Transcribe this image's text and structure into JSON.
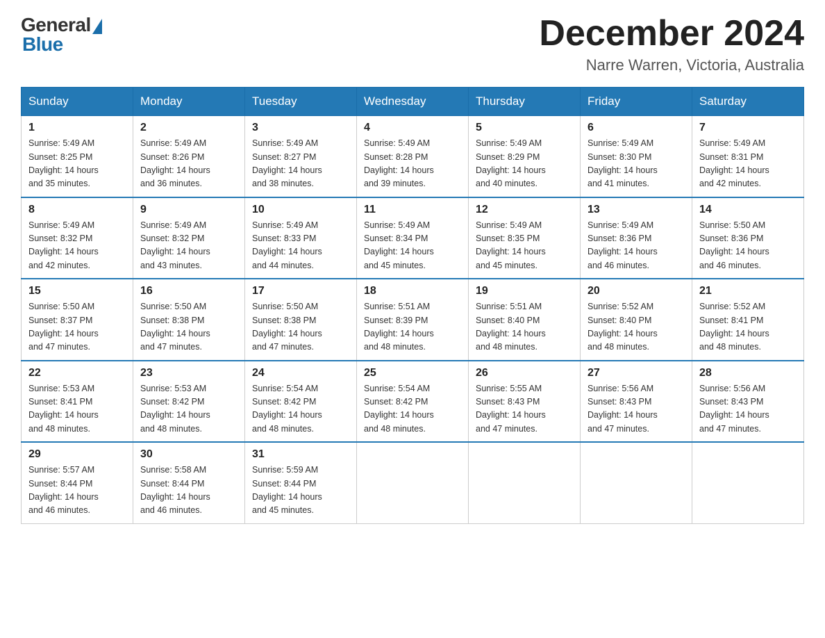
{
  "header": {
    "logo_general": "General",
    "logo_blue": "Blue",
    "month_title": "December 2024",
    "location": "Narre Warren, Victoria, Australia"
  },
  "days_of_week": [
    "Sunday",
    "Monday",
    "Tuesday",
    "Wednesday",
    "Thursday",
    "Friday",
    "Saturday"
  ],
  "weeks": [
    [
      {
        "day": "1",
        "sunrise": "5:49 AM",
        "sunset": "8:25 PM",
        "daylight": "14 hours and 35 minutes."
      },
      {
        "day": "2",
        "sunrise": "5:49 AM",
        "sunset": "8:26 PM",
        "daylight": "14 hours and 36 minutes."
      },
      {
        "day": "3",
        "sunrise": "5:49 AM",
        "sunset": "8:27 PM",
        "daylight": "14 hours and 38 minutes."
      },
      {
        "day": "4",
        "sunrise": "5:49 AM",
        "sunset": "8:28 PM",
        "daylight": "14 hours and 39 minutes."
      },
      {
        "day": "5",
        "sunrise": "5:49 AM",
        "sunset": "8:29 PM",
        "daylight": "14 hours and 40 minutes."
      },
      {
        "day": "6",
        "sunrise": "5:49 AM",
        "sunset": "8:30 PM",
        "daylight": "14 hours and 41 minutes."
      },
      {
        "day": "7",
        "sunrise": "5:49 AM",
        "sunset": "8:31 PM",
        "daylight": "14 hours and 42 minutes."
      }
    ],
    [
      {
        "day": "8",
        "sunrise": "5:49 AM",
        "sunset": "8:32 PM",
        "daylight": "14 hours and 42 minutes."
      },
      {
        "day": "9",
        "sunrise": "5:49 AM",
        "sunset": "8:32 PM",
        "daylight": "14 hours and 43 minutes."
      },
      {
        "day": "10",
        "sunrise": "5:49 AM",
        "sunset": "8:33 PM",
        "daylight": "14 hours and 44 minutes."
      },
      {
        "day": "11",
        "sunrise": "5:49 AM",
        "sunset": "8:34 PM",
        "daylight": "14 hours and 45 minutes."
      },
      {
        "day": "12",
        "sunrise": "5:49 AM",
        "sunset": "8:35 PM",
        "daylight": "14 hours and 45 minutes."
      },
      {
        "day": "13",
        "sunrise": "5:49 AM",
        "sunset": "8:36 PM",
        "daylight": "14 hours and 46 minutes."
      },
      {
        "day": "14",
        "sunrise": "5:50 AM",
        "sunset": "8:36 PM",
        "daylight": "14 hours and 46 minutes."
      }
    ],
    [
      {
        "day": "15",
        "sunrise": "5:50 AM",
        "sunset": "8:37 PM",
        "daylight": "14 hours and 47 minutes."
      },
      {
        "day": "16",
        "sunrise": "5:50 AM",
        "sunset": "8:38 PM",
        "daylight": "14 hours and 47 minutes."
      },
      {
        "day": "17",
        "sunrise": "5:50 AM",
        "sunset": "8:38 PM",
        "daylight": "14 hours and 47 minutes."
      },
      {
        "day": "18",
        "sunrise": "5:51 AM",
        "sunset": "8:39 PM",
        "daylight": "14 hours and 48 minutes."
      },
      {
        "day": "19",
        "sunrise": "5:51 AM",
        "sunset": "8:40 PM",
        "daylight": "14 hours and 48 minutes."
      },
      {
        "day": "20",
        "sunrise": "5:52 AM",
        "sunset": "8:40 PM",
        "daylight": "14 hours and 48 minutes."
      },
      {
        "day": "21",
        "sunrise": "5:52 AM",
        "sunset": "8:41 PM",
        "daylight": "14 hours and 48 minutes."
      }
    ],
    [
      {
        "day": "22",
        "sunrise": "5:53 AM",
        "sunset": "8:41 PM",
        "daylight": "14 hours and 48 minutes."
      },
      {
        "day": "23",
        "sunrise": "5:53 AM",
        "sunset": "8:42 PM",
        "daylight": "14 hours and 48 minutes."
      },
      {
        "day": "24",
        "sunrise": "5:54 AM",
        "sunset": "8:42 PM",
        "daylight": "14 hours and 48 minutes."
      },
      {
        "day": "25",
        "sunrise": "5:54 AM",
        "sunset": "8:42 PM",
        "daylight": "14 hours and 48 minutes."
      },
      {
        "day": "26",
        "sunrise": "5:55 AM",
        "sunset": "8:43 PM",
        "daylight": "14 hours and 47 minutes."
      },
      {
        "day": "27",
        "sunrise": "5:56 AM",
        "sunset": "8:43 PM",
        "daylight": "14 hours and 47 minutes."
      },
      {
        "day": "28",
        "sunrise": "5:56 AM",
        "sunset": "8:43 PM",
        "daylight": "14 hours and 47 minutes."
      }
    ],
    [
      {
        "day": "29",
        "sunrise": "5:57 AM",
        "sunset": "8:44 PM",
        "daylight": "14 hours and 46 minutes."
      },
      {
        "day": "30",
        "sunrise": "5:58 AM",
        "sunset": "8:44 PM",
        "daylight": "14 hours and 46 minutes."
      },
      {
        "day": "31",
        "sunrise": "5:59 AM",
        "sunset": "8:44 PM",
        "daylight": "14 hours and 45 minutes."
      },
      null,
      null,
      null,
      null
    ]
  ],
  "labels": {
    "sunrise": "Sunrise:",
    "sunset": "Sunset:",
    "daylight": "Daylight:"
  }
}
